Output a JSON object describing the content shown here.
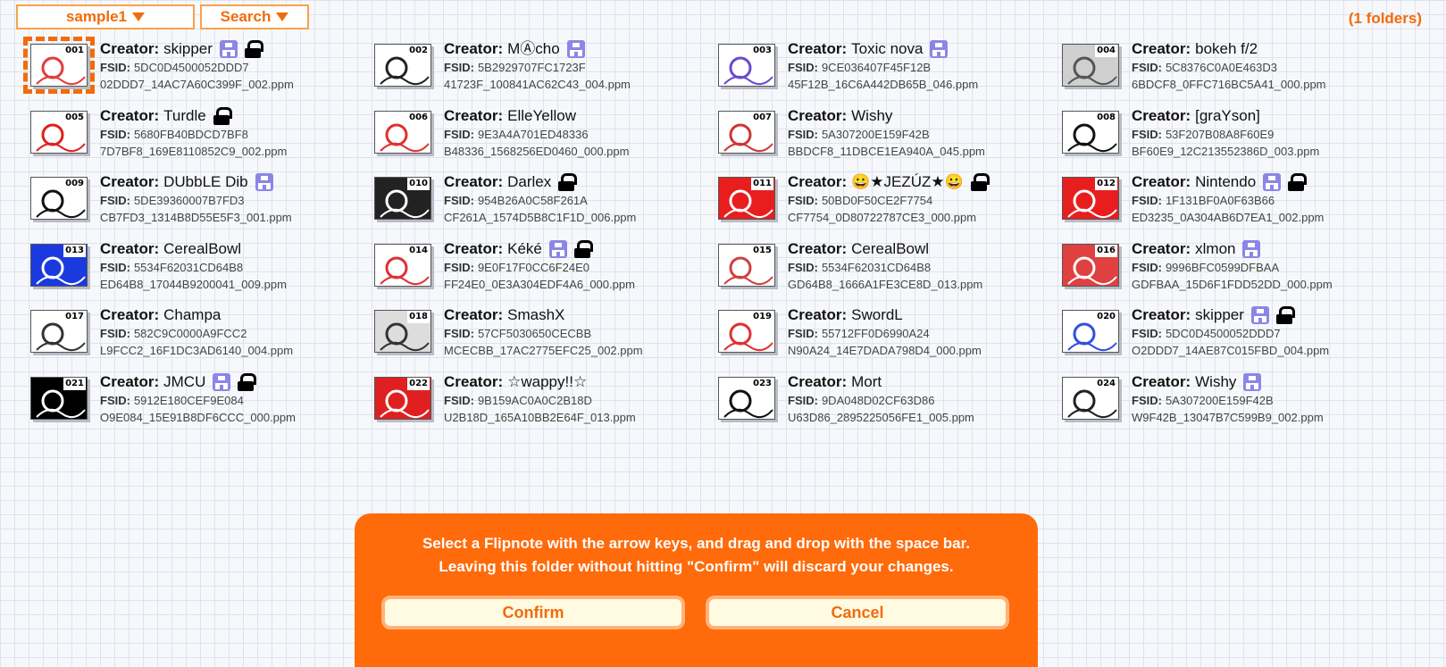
{
  "toolbar": {
    "folder_label": "sample1",
    "search_label": "Search",
    "folder_count": "(1 folders)"
  },
  "labels": {
    "creator": "Creator:",
    "fsid": "FSID:"
  },
  "items": [
    {
      "num": "001",
      "creator": "skipper",
      "fsid": "5DC0D4500052DDD7",
      "file": "02DDD7_14AC7A60C399F_002.ppm",
      "share": true,
      "lock": true,
      "bg": "#ffffff",
      "fg": "#e63a3a",
      "selected": true
    },
    {
      "num": "002",
      "creator": "MⒶcho",
      "fsid": "5B2929707FC1723F",
      "file": "41723F_100841AC62C43_004.ppm",
      "share": true,
      "lock": false,
      "bg": "#ffffff",
      "fg": "#222222"
    },
    {
      "num": "003",
      "creator": "Toxic nova",
      "fsid": "9CE036407F45F12B",
      "file": "45F12B_16C6A442DB65B_046.ppm",
      "share": true,
      "lock": false,
      "bg": "#ffffff",
      "fg": "#6a4ad0"
    },
    {
      "num": "004",
      "creator": "bokeh f/2",
      "fsid": "5C8376C0A0E463D3",
      "file": "6BDCF8_0FFC716BC5A41_000.ppm",
      "share": false,
      "lock": false,
      "bg": "#cfcfcf",
      "fg": "#555555"
    },
    {
      "num": "005",
      "creator": "Turdle",
      "fsid": "5680FB40BDCD7BF8",
      "file": "7D7BF8_169E8110852C9_002.ppm",
      "share": false,
      "lock": true,
      "bg": "#ffffff",
      "fg": "#e01f1f"
    },
    {
      "num": "006",
      "creator": "ElleYellow",
      "fsid": "9E3A4A701ED48336",
      "file": "B48336_1568256ED0460_000.ppm",
      "share": false,
      "lock": false,
      "bg": "#ffffff",
      "fg": "#e03030"
    },
    {
      "num": "007",
      "creator": "Wishy",
      "fsid": "5A307200E159F42B",
      "file": "BBDCF8_11DBCE1EA940A_045.ppm",
      "share": false,
      "lock": false,
      "bg": "#ffffff",
      "fg": "#d23535"
    },
    {
      "num": "008",
      "creator": "[graYson]",
      "fsid": "53F207B08A8F60E9",
      "file": "BF60E9_12C213552386D_003.ppm",
      "share": false,
      "lock": false,
      "bg": "#ffffff",
      "fg": "#111111"
    },
    {
      "num": "009",
      "creator": "DUbbLE Dib",
      "fsid": "5DE39360007B7FD3",
      "file": "CB7FD3_1314B8D55E5F3_001.ppm",
      "share": true,
      "lock": false,
      "bg": "#ffffff",
      "fg": "#111111"
    },
    {
      "num": "010",
      "creator": "Darlex",
      "fsid": "954B26A0C58F261A",
      "file": "CF261A_1574D5B8C1F1D_006.ppm",
      "share": false,
      "lock": true,
      "bg": "#222222",
      "fg": "#ffffff"
    },
    {
      "num": "011",
      "creator": "😀★JEZÚZ★😀",
      "fsid": "50BD0F50CE2F7754",
      "file": "CF7754_0D80722787CE3_000.ppm",
      "share": false,
      "lock": true,
      "bg": "#e81e1e",
      "fg": "#ffffff"
    },
    {
      "num": "012",
      "creator": "Nintendo",
      "fsid": "1F131BF0A0F63B66",
      "file": "ED3235_0A304AB6D7EA1_002.ppm",
      "share": true,
      "lock": true,
      "bg": "#e81e1e",
      "fg": "#ffffff"
    },
    {
      "num": "013",
      "creator": "CerealBowl",
      "fsid": "5534F62031CD64B8",
      "file": "ED64B8_17044B9200041_009.ppm",
      "share": false,
      "lock": false,
      "bg": "#1a3ae0",
      "fg": "#ffffff"
    },
    {
      "num": "014",
      "creator": "Kéké",
      "fsid": "9E0F17F0CC6F24E0",
      "file": "FF24E0_0E3A304EDF4A6_000.ppm",
      "share": true,
      "lock": true,
      "bg": "#ffffff",
      "fg": "#e03030"
    },
    {
      "num": "015",
      "creator": "CerealBowl",
      "fsid": "5534F62031CD64B8",
      "file": "GD64B8_1666A1FE3CE8D_013.ppm",
      "share": false,
      "lock": false,
      "bg": "#ffffff",
      "fg": "#d04040"
    },
    {
      "num": "016",
      "creator": "xlmon",
      "fsid": "9996BFC0599DFBAA",
      "file": "GDFBAA_15D6F1FDD52DD_000.ppm",
      "share": true,
      "lock": false,
      "bg": "#e04040",
      "fg": "#ffffff"
    },
    {
      "num": "017",
      "creator": "Champa",
      "fsid": "582C9C0000A9FCC2",
      "file": "L9FCC2_16F1DC3AD6140_004.ppm",
      "share": false,
      "lock": false,
      "bg": "#ffffff",
      "fg": "#333333"
    },
    {
      "num": "018",
      "creator": "SmashX",
      "fsid": "57CF5030650CECBB",
      "file": "MCECBB_17AC2775EFC25_002.ppm",
      "share": false,
      "lock": false,
      "bg": "#dddddd",
      "fg": "#333333"
    },
    {
      "num": "019",
      "creator": "SwordL",
      "fsid": "55712FF0D6990A24",
      "file": "N90A24_14E7DADA798D4_000.ppm",
      "share": false,
      "lock": false,
      "bg": "#ffffff",
      "fg": "#e03030"
    },
    {
      "num": "020",
      "creator": "skipper",
      "fsid": "5DC0D4500052DDD7",
      "file": "O2DDD7_14AE87C015FBD_004.ppm",
      "share": true,
      "lock": true,
      "bg": "#ffffff",
      "fg": "#3050e0"
    },
    {
      "num": "021",
      "creator": "JMCU",
      "fsid": "5912E180CEF9E084",
      "file": "O9E084_15E91B8DF6CCC_000.ppm",
      "share": true,
      "lock": true,
      "bg": "#000000",
      "fg": "#ffffff"
    },
    {
      "num": "022",
      "creator": "☆wappy!!☆",
      "fsid": "9B159AC0A0C2B18D",
      "file": "U2B18D_165A10BB2E64F_013.ppm",
      "share": false,
      "lock": false,
      "bg": "#e02020",
      "fg": "#ffffff"
    },
    {
      "num": "023",
      "creator": "Mort",
      "fsid": "9DA048D02CF63D86",
      "file": "U63D86_2895225056FE1_005.ppm",
      "share": false,
      "lock": false,
      "bg": "#ffffff",
      "fg": "#111111"
    },
    {
      "num": "024",
      "creator": "Wishy",
      "fsid": "5A307200E159F42B",
      "file": "W9F42B_13047B7C599B9_002.ppm",
      "share": true,
      "lock": false,
      "bg": "#ffffff",
      "fg": "#222222"
    }
  ],
  "dialog": {
    "line1": "Select a Flipnote with the arrow keys, and drag and drop with the space bar.",
    "line2": "Leaving this folder without hitting \"Confirm\" will discard your changes.",
    "confirm": "Confirm",
    "cancel": "Cancel"
  }
}
